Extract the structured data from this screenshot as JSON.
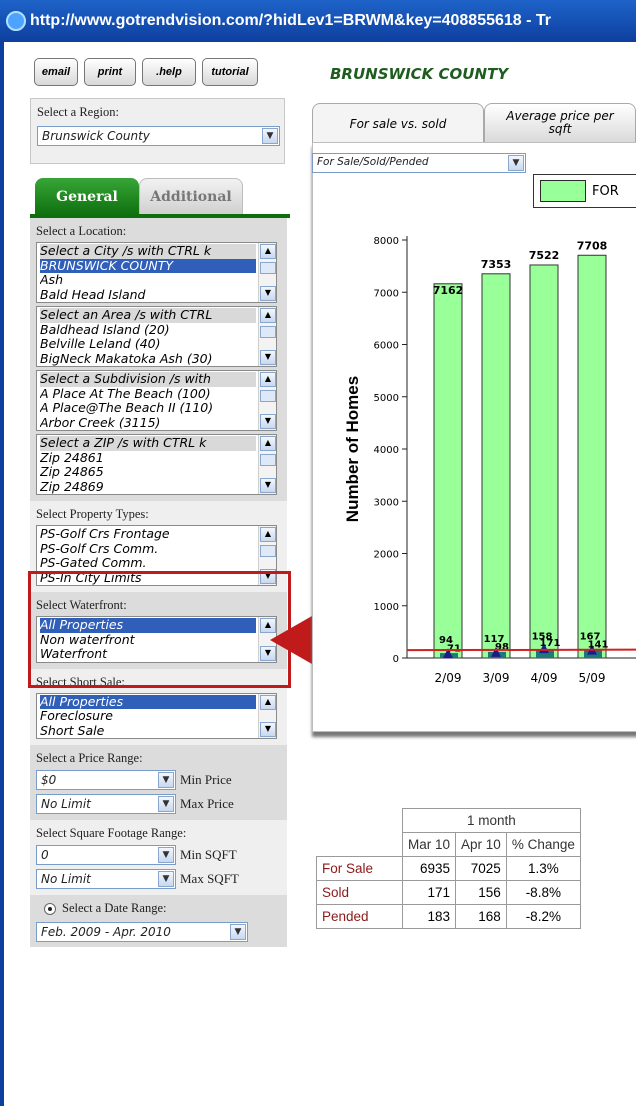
{
  "browser": {
    "title": "http://www.gotrendvision.com/?hidLev1=BRWM&key=408855618 - Tr"
  },
  "toolbar": {
    "buttons": [
      "email",
      "print",
      ".help",
      "tutorial"
    ]
  },
  "region": {
    "label": "Select a Region:",
    "value": "Brunswick County"
  },
  "tabs": {
    "general": "General",
    "additional": "Additional"
  },
  "location": {
    "label": "Select a Location:",
    "city_list": [
      "Select a City /s with CTRL k",
      "BRUNSWICK COUNTY",
      "Ash",
      "Bald Head Island"
    ],
    "area_list": [
      "Select an Area /s with CTRL",
      "Baldhead Island (20)",
      "Belville Leland (40)",
      "BigNeck Makatoka Ash (30)"
    ],
    "subdivision_list": [
      "Select a Subdivision /s with",
      "A Place At The Beach (100)",
      "A Place@The Beach II (110)",
      "Arbor Creek (3115)"
    ],
    "zip_list": [
      "Select a ZIP /s with CTRL k",
      "Zip 24861",
      "Zip 24865",
      "Zip 24869"
    ]
  },
  "property_types": {
    "label": "Select Property Types:",
    "items": [
      "PS-Golf Crs Frontage",
      "PS-Golf Crs Comm.",
      "PS-Gated Comm.",
      "PS-In City Limits"
    ]
  },
  "waterfront": {
    "label": "Select Waterfront:",
    "items": [
      "All Properties",
      "Non waterfront",
      "Waterfront"
    ]
  },
  "short_sale": {
    "label": "Select Short Sale:",
    "items": [
      "All Properties",
      "Foreclosure",
      "Short Sale"
    ]
  },
  "price": {
    "label": "Select a Price Range:",
    "min_value": "$0",
    "min_label": "Min Price",
    "max_value": "No Limit",
    "max_label": "Max Price"
  },
  "sqft": {
    "label": "Select Square Footage Range:",
    "min_value": "0",
    "min_label": "Min SQFT",
    "max_value": "No Limit",
    "max_label": "Max SQFT"
  },
  "date": {
    "label": "Select a Date Range:",
    "value": "Feb. 2009 - Apr. 2010"
  },
  "main": {
    "county_title": "BRUNSWICK COUNTY",
    "tab1": "For sale vs. sold",
    "tab2": "Average price per sqft",
    "chart_select": "For Sale/Sold/Pended",
    "legend_label": "FOR"
  },
  "chart_data": {
    "type": "bar",
    "categories": [
      "2/09",
      "3/09",
      "4/09",
      "5/09"
    ],
    "series": [
      {
        "name": "FOR",
        "values": [
          7162,
          7353,
          7522,
          7708
        ],
        "color": "#99ff99"
      },
      {
        "values": [
          94,
          117,
          158,
          167
        ],
        "color": "#1d7a7a"
      },
      {
        "values": [
          71,
          98,
          171,
          141
        ],
        "color": "#1c1c8c"
      }
    ],
    "ylabel": "Number of Homes",
    "ylim": [
      0,
      8000
    ],
    "yticks": [
      0,
      1000,
      2000,
      3000,
      4000,
      5000,
      6000,
      7000,
      8000
    ]
  },
  "table": {
    "period": "1 month",
    "headers": [
      "Mar 10",
      "Apr 10",
      "% Change"
    ],
    "rows": [
      {
        "label": "For Sale",
        "mar": "6935",
        "apr": "7025",
        "change": "1.3%"
      },
      {
        "label": "Sold",
        "mar": "171",
        "apr": "156",
        "change": "-8.8%"
      },
      {
        "label": "Pended",
        "mar": "183",
        "apr": "168",
        "change": "-8.2%"
      }
    ]
  },
  "colors": {
    "accent_green": "#0e6e0e",
    "highlight_red": "#c01a1a",
    "title_bar": "#0d3f9e"
  }
}
